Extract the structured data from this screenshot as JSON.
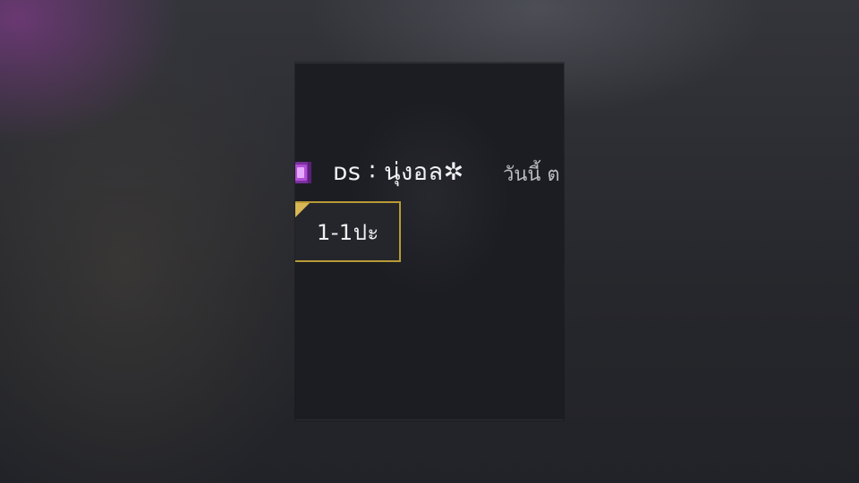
{
  "chat": {
    "message": {
      "sender": "ᴅs ∶ นุ่งอล✲",
      "timestamp": "วันนี้ ต",
      "text": "1-1ปะ"
    }
  },
  "colors": {
    "bubble_border": "#b89a36",
    "badge": "#8a3fb0",
    "panel_background": "#1c1d22"
  }
}
